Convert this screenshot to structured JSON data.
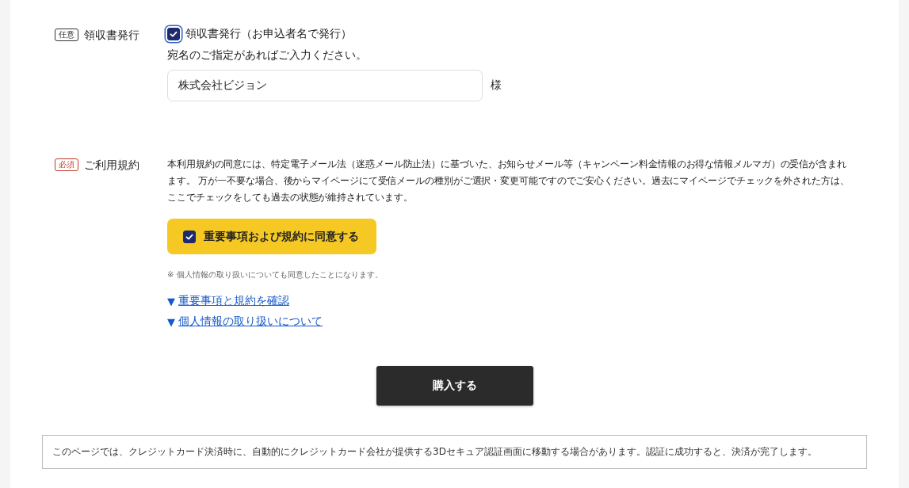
{
  "receipt": {
    "badge": "任意",
    "label": "領収書発行",
    "checkbox": {
      "label": "領収書発行（お申込者名で発行）",
      "checked": true
    },
    "hint": "宛名のご指定があればご入力ください。",
    "field": {
      "value": "株式会社ビジョン"
    },
    "suffix": "様"
  },
  "terms": {
    "badge": "必須",
    "label": "ご利用規約",
    "body": "本利用規約の同意には、特定電子メール法（迷惑メール防止法）に基づいた、お知らせメール等（キャンペーン料金情報のお得な情報メルマガ）の受信が含まれます。 万が一不要な場合、後からマイページにて受信メールの種別がご選択・変更可能ですのでご安心ください。過去にマイページでチェックを外された方は、ここでチェックをしても過去の状態が維持されています。",
    "agree": {
      "label": "重要事項および規約に同意する",
      "checked": true
    },
    "note": "※ 個人情報の取り扱いについても同意したことになります。",
    "links": [
      {
        "marker": "▼",
        "label": "重要事項と規約を確認"
      },
      {
        "marker": "▼",
        "label": "個人情報の取り扱いについて"
      }
    ]
  },
  "submit": "購入する",
  "footer_note": "このページでは、クレジットカード決済時に、自動的にクレジットカード会社が提供する3Dセキュア認証画面に移動する場合があります。認証に成功すると、決済が完了します。"
}
